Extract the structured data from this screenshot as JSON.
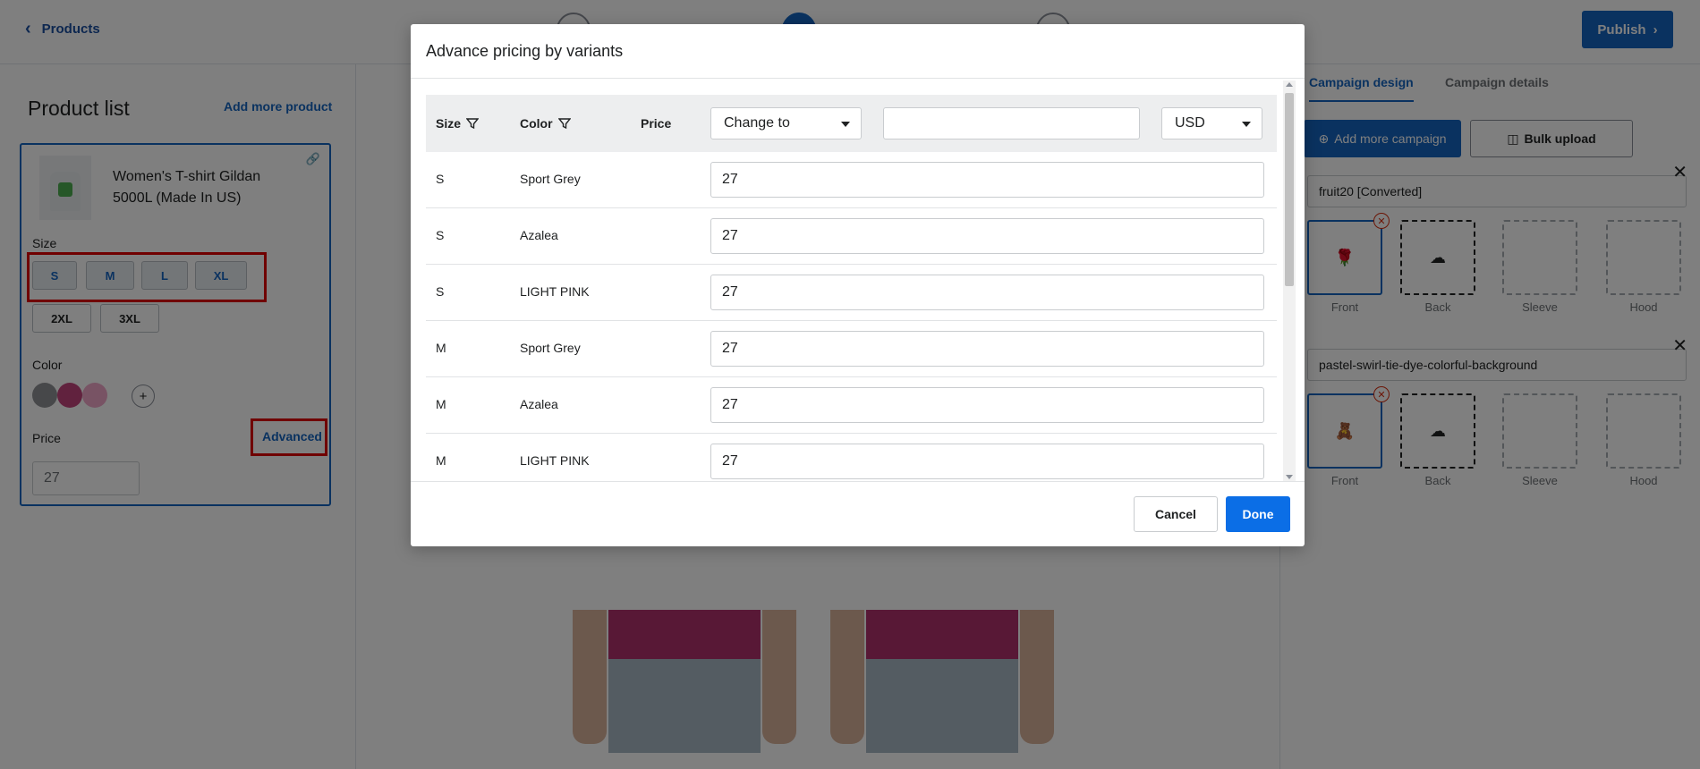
{
  "header": {
    "back_label": "Products",
    "publish_label": "Publish"
  },
  "left_panel": {
    "title": "Product list",
    "add_more_label": "Add more product",
    "product": {
      "name": "Women's T-shirt Gildan 5000L (Made In US)",
      "size_label": "Size",
      "sizes": [
        "S",
        "M",
        "L",
        "XL",
        "2XL",
        "3XL"
      ],
      "color_label": "Color",
      "colors": [
        "#8f9194",
        "#c2457c",
        "#f0a6c8"
      ],
      "add_color_label": "+",
      "price_label": "Price",
      "advanced_label": "Advanced",
      "price_value": "27"
    }
  },
  "right_panel": {
    "tabs": [
      "Campaign design",
      "Campaign details"
    ],
    "add_campaign_label": "Add more campaign",
    "bulk_upload_label": "Bulk upload",
    "campaigns": [
      {
        "name": "fruit20 [Converted]",
        "slots": [
          "Front",
          "Back",
          "Sleeve",
          "Hood"
        ]
      },
      {
        "name": "pastel-swirl-tie-dye-colorful-background",
        "slots": [
          "Front",
          "Back",
          "Sleeve",
          "Hood"
        ]
      }
    ]
  },
  "modal": {
    "title": "Advance pricing by variants",
    "headers": {
      "size": "Size",
      "color": "Color",
      "price": "Price"
    },
    "change_select": "Change to",
    "value_input": "",
    "currency": "USD",
    "rows": [
      {
        "size": "S",
        "color": "Sport Grey",
        "price": "27"
      },
      {
        "size": "S",
        "color": "Azalea",
        "price": "27"
      },
      {
        "size": "S",
        "color": "LIGHT PINK",
        "price": "27"
      },
      {
        "size": "M",
        "color": "Sport Grey",
        "price": "27"
      },
      {
        "size": "M",
        "color": "Azalea",
        "price": "27"
      },
      {
        "size": "M",
        "color": "LIGHT PINK",
        "price": "27"
      }
    ],
    "cancel_label": "Cancel",
    "done_label": "Done"
  },
  "theme": {
    "primary": "#1565c0",
    "done_button": "#0b6ee6",
    "highlight": "#e00000"
  }
}
